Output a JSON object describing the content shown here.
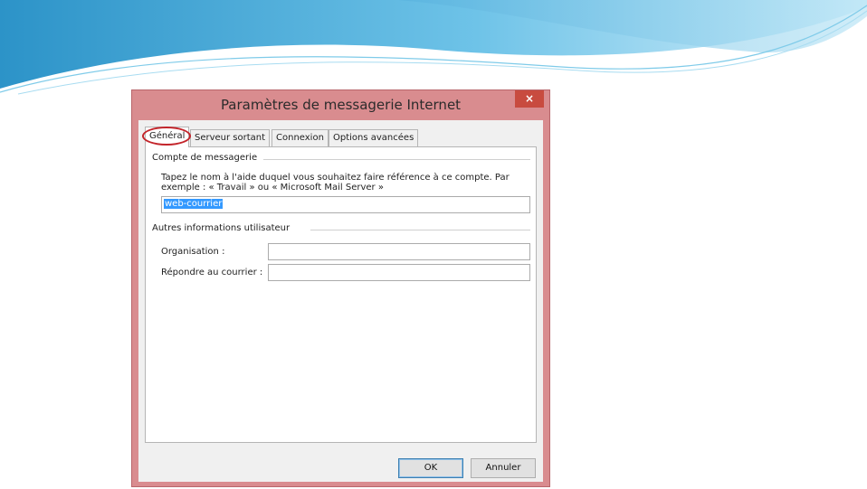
{
  "dialog": {
    "title": "Paramètres de messagerie Internet",
    "close_label": "×",
    "accent_color": "#d98c8f",
    "close_color": "#c84b3f"
  },
  "tabs": [
    {
      "label": "Général",
      "active": true
    },
    {
      "label": "Serveur sortant",
      "active": false
    },
    {
      "label": "Connexion",
      "active": false
    },
    {
      "label": "Options avancées",
      "active": false
    }
  ],
  "mail_account": {
    "section_label": "Compte de messagerie",
    "description_line1": "Tapez le nom à l'aide duquel vous souhaitez faire référence à ce compte. Par",
    "description_line2": "exemple : « Travail » ou « Microsoft Mail Server »",
    "account_name_value": "web-courrier"
  },
  "other_user_info": {
    "section_label": "Autres informations utilisateur",
    "organization_label": "Organisation :",
    "organization_value": "",
    "reply_to_label": "Répondre au courrier :",
    "reply_to_value": ""
  },
  "buttons": {
    "ok_label": "OK",
    "cancel_label": "Annuler"
  },
  "annotation": {
    "highlight_color": "#c3242a",
    "highlighted_tab": "Général"
  },
  "icons": [
    "close-icon",
    "decorative-swoosh"
  ]
}
